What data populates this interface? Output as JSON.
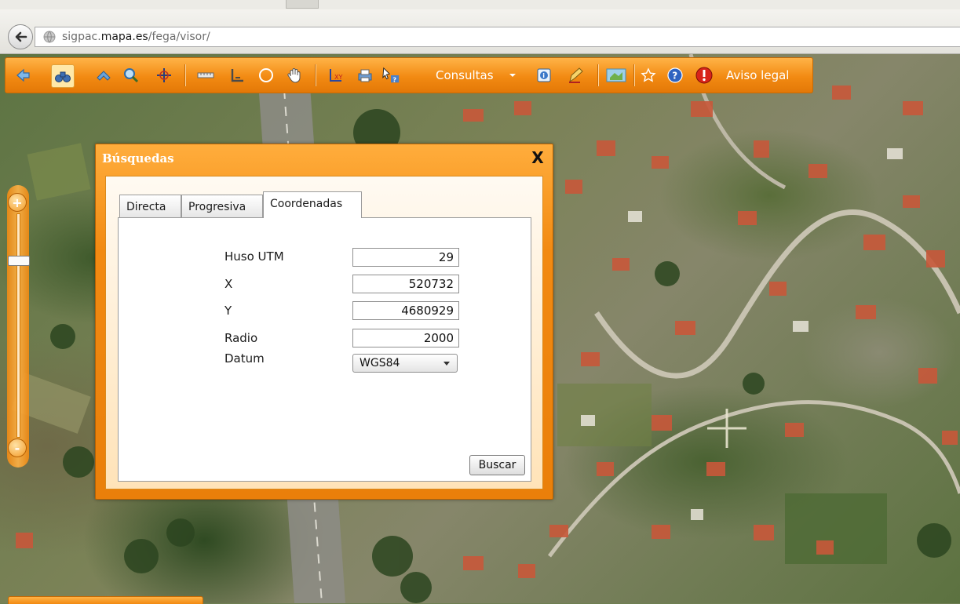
{
  "browser": {
    "url_prefix": "sigpac.",
    "url_domain": "mapa.es",
    "url_path": "/fega/visor/"
  },
  "toolbar": {
    "consultas_label": "Consultas",
    "aviso_legal_label": "Aviso legal",
    "icons": [
      "back-arrow-icon",
      "binoculars-icon",
      "pan-icon",
      "zoom-icon",
      "crosshair-icon",
      "ruler-icon",
      "area-measure-icon",
      "circle-icon",
      "hand-icon",
      "xy-coordinates-icon",
      "print-icon",
      "identify-icon",
      "chevron-down-icon",
      "info-icon",
      "edit-icon",
      "map-layers-icon",
      "star-icon",
      "help-icon",
      "warning-icon"
    ],
    "accent": "#f28a12"
  },
  "dialog": {
    "title": "Búsquedas",
    "close_label": "X",
    "tabs": [
      {
        "label": "Directa",
        "selected": false
      },
      {
        "label": "Progresiva",
        "selected": false
      },
      {
        "label": "Coordenadas",
        "selected": true
      }
    ],
    "fields": [
      {
        "label": "Huso UTM",
        "value": "29"
      },
      {
        "label": "X",
        "value": "520732"
      },
      {
        "label": "Y",
        "value": "4680929"
      },
      {
        "label": "Radio",
        "value": "2000"
      }
    ],
    "datum": {
      "label": "Datum",
      "value": "WGS84"
    },
    "search_button": "Buscar"
  },
  "zoom": {
    "in_label": "+",
    "out_label": "-"
  }
}
